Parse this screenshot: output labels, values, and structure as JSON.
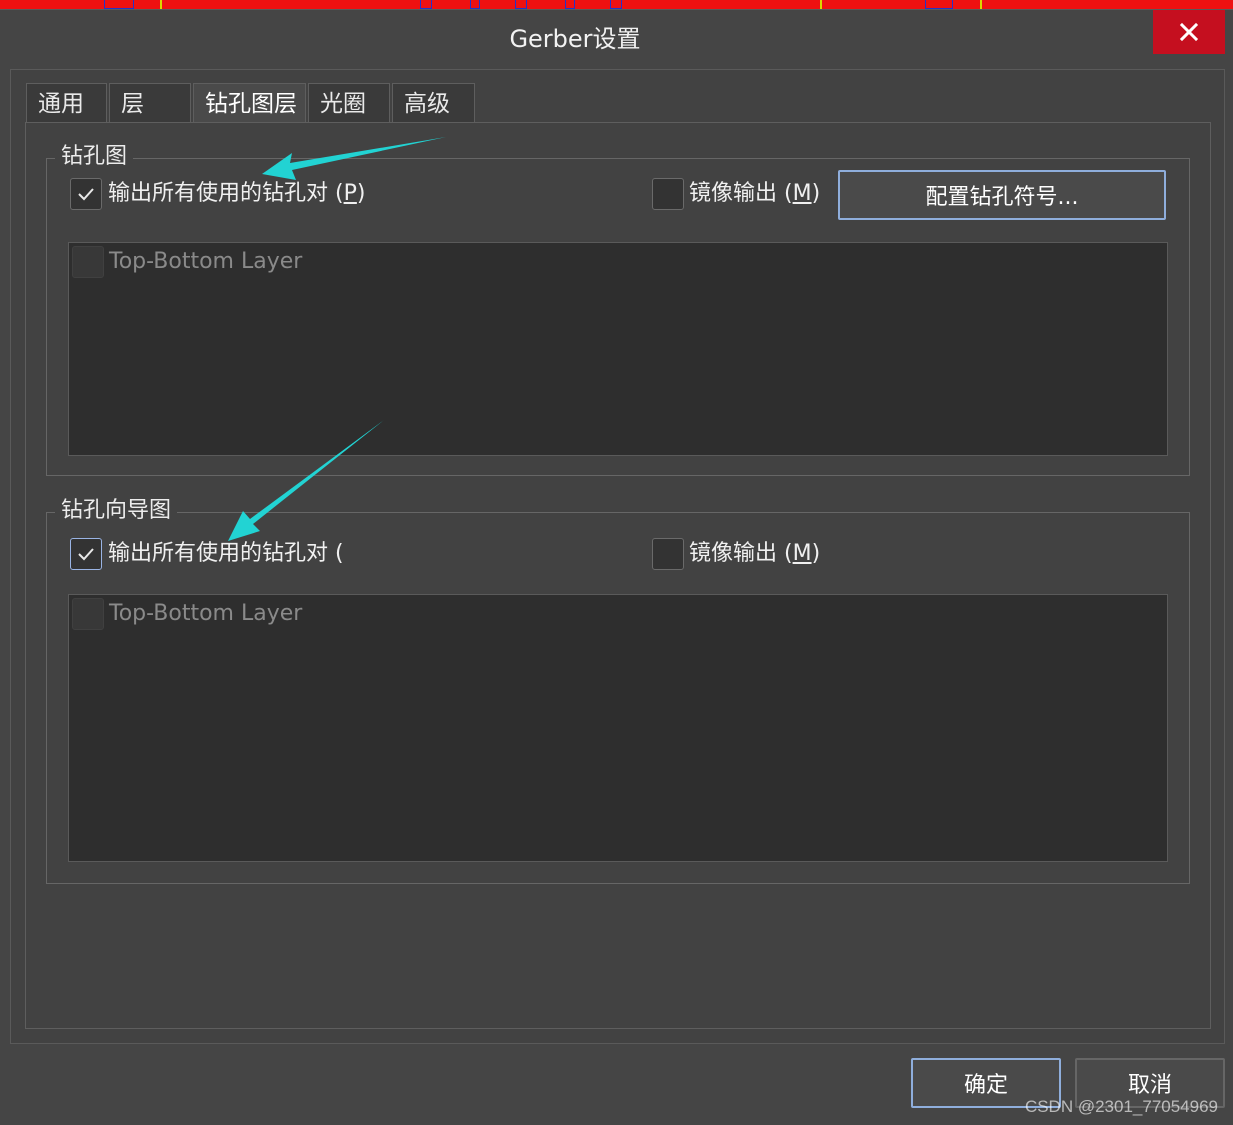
{
  "window": {
    "title": "Gerber设置",
    "close_icon": "close-icon"
  },
  "tabs": [
    {
      "label": "通用",
      "active": false
    },
    {
      "label": "层",
      "active": false
    },
    {
      "label": "钻孔图层",
      "active": true
    },
    {
      "label": "光圈",
      "active": false
    },
    {
      "label": "高级",
      "active": false
    }
  ],
  "drill_drawing": {
    "title": "钻孔图",
    "output_all_pairs": {
      "label_main": "输出所有使用的钻孔对 (",
      "label_key": "P",
      "label_end": ")",
      "checked": true
    },
    "mirror_output": {
      "label_main": "镜像输出 (",
      "label_key": "M",
      "label_end": ")",
      "checked": false
    },
    "configure_button": "配置钻孔符号...",
    "layer_items": [
      {
        "label": "Top-Bottom Layer",
        "checked": false,
        "disabled": true
      }
    ]
  },
  "drill_guide": {
    "title": "钻孔向导图",
    "output_all_pairs": {
      "label_main": "输出所有使用的钻孔对 (",
      "checked": true
    },
    "mirror_output": {
      "label_main": "镜像输出 (",
      "label_key": "M",
      "label_end": ")",
      "checked": false
    },
    "layer_items": [
      {
        "label": "Top-Bottom Layer",
        "checked": false,
        "disabled": true
      }
    ]
  },
  "footer": {
    "ok_button": "确定",
    "cancel_button": "取消"
  },
  "watermark": "CSDN @2301_77054969",
  "colors": {
    "dialog_bg": "#454545",
    "close_red": "#c50f1f",
    "accent_border": "#8faedc",
    "annotation_arrow": "#22d3d3"
  }
}
